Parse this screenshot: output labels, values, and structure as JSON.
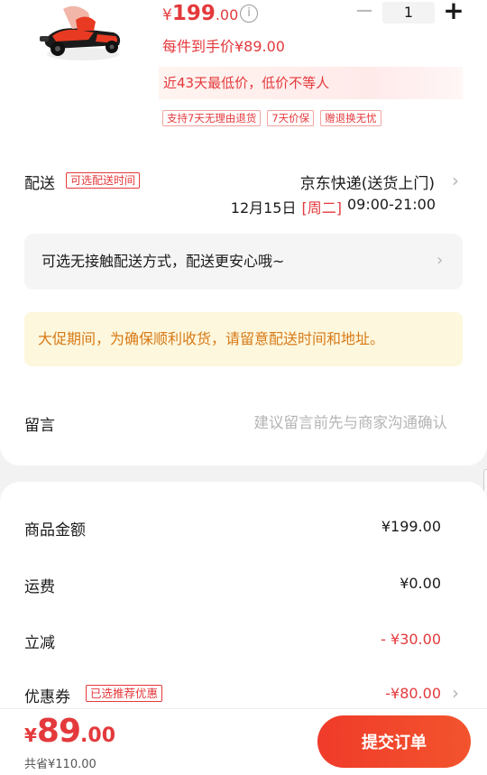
{
  "product": {
    "price_yen": "¥",
    "price_int": "199",
    "price_dec": ".00",
    "info_icon": "info-icon",
    "quantity_value": "1",
    "minus_symbol": "−",
    "plus_symbol": "+",
    "hand_price": "每件到手价¥89.00",
    "lowest_price_note": "近43天最低价，低价不等人",
    "tags": [
      "支持7天无理由退货",
      "7天价保",
      "赠退换无忧"
    ]
  },
  "delivery": {
    "label": "配送",
    "badge": "可选配送时间",
    "courier": "京东快递(送货上门)",
    "date": "12月15日",
    "weekday": "[周二]",
    "time_window": "09:00-21:00",
    "contactless_text": "可选无接触配送方式，配送更安心哦~"
  },
  "promo_notice": "大促期间，为确保顺利收货，请留意配送时间和地址。",
  "message": {
    "label": "留言",
    "placeholder": "建议留言前先与商家沟通确认"
  },
  "summary": {
    "goods_label": "商品金额",
    "goods_value": "¥199.00",
    "shipping_label": "运费",
    "shipping_value": "¥0.00",
    "discount_label": "立减",
    "discount_value": "- ¥30.00",
    "coupon_label": "优惠券",
    "coupon_badge": "已选推荐优惠",
    "coupon_value": "-¥80.00"
  },
  "footer": {
    "total_yen": "¥",
    "total_int": "89",
    "total_dec": ".00",
    "saved_text": "共省¥110.00",
    "submit_label": "提交订单"
  },
  "colors": {
    "accent_red": "#e4393c",
    "promo_orange": "#d77a17",
    "promo_bg": "#fdf7dd"
  },
  "chevron_glyph": "›"
}
